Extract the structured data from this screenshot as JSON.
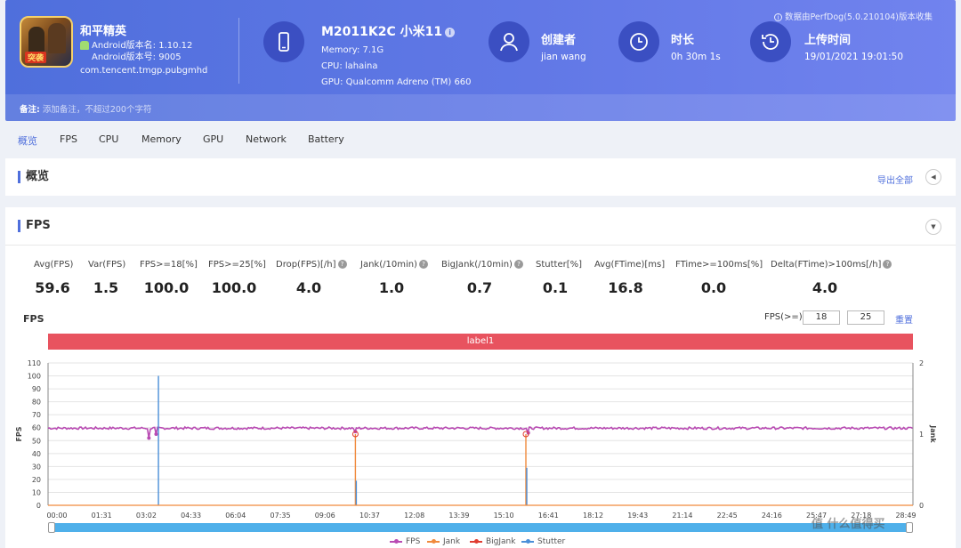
{
  "app": {
    "name": "和平精英",
    "icon_badge": "突袭",
    "version_name": "Android版本名: 1.10.12",
    "version_code": "Android版本号: 9005",
    "package": "com.tencent.tmgp.pubgmhd"
  },
  "device": {
    "name": "M2011K2C 小米11",
    "memory": "Memory: 7.1G",
    "cpu": "CPU: lahaina",
    "gpu": "GPU: Qualcomm Adreno (TM) 660"
  },
  "creator": {
    "title": "创建者",
    "value": "jian wang"
  },
  "duration": {
    "title": "时长",
    "value": "0h 30m 1s"
  },
  "upload": {
    "title": "上传时间",
    "value": "19/01/2021 19:01:50"
  },
  "notice": "数据由PerfDog(5.0.210104)版本收集",
  "note": {
    "label": "备注:",
    "placeholder": "添加备注，不超过200个字符"
  },
  "tabs": [
    "概览",
    "FPS",
    "CPU",
    "Memory",
    "GPU",
    "Network",
    "Battery"
  ],
  "overview": {
    "title": "概览",
    "export": "导出全部"
  },
  "fps_section": {
    "title": "FPS"
  },
  "metrics": [
    {
      "label": "Avg(FPS)",
      "value": "59.6"
    },
    {
      "label": "Var(FPS)",
      "value": "1.5"
    },
    {
      "label": "FPS>=18[%]",
      "value": "100.0"
    },
    {
      "label": "FPS>=25[%]",
      "value": "100.0"
    },
    {
      "label": "Drop(FPS)[/h]",
      "value": "4.0"
    },
    {
      "label": "Jank(/10min)",
      "value": "1.0"
    },
    {
      "label": "BigJank(/10min)",
      "value": "0.7"
    },
    {
      "label": "Stutter[%]",
      "value": "0.1"
    },
    {
      "label": "Avg(FTime)[ms]",
      "value": "16.8"
    },
    {
      "label": "FTime>=100ms[%]",
      "value": "0.0"
    },
    {
      "label": "Delta(FTime)>100ms[/h]",
      "value": "4.0"
    }
  ],
  "chart_controls": {
    "title": "FPS",
    "threshold_label": "FPS(>=)",
    "threshold_1": "18",
    "threshold_2": "25",
    "reset": "重置",
    "label_bar": "label1"
  },
  "watermark": "值 什么值得买",
  "colors": {
    "accent": "#4f6fdc",
    "fps": "#b94bb3",
    "jank": "#f08a3c",
    "bigjank": "#e03c31",
    "stutter": "#4a8fd8",
    "label": "#e8535f"
  },
  "chart_data": {
    "type": "line",
    "ylabel": "FPS",
    "y2label": "Jank",
    "ylim": [
      0,
      110
    ],
    "y2lim": [
      0,
      2
    ],
    "yticks": [
      0,
      10,
      20,
      30,
      40,
      50,
      60,
      70,
      80,
      90,
      100,
      110
    ],
    "y2ticks": [
      0,
      1,
      2
    ],
    "xticks": [
      "00:00",
      "01:31",
      "03:02",
      "04:33",
      "06:04",
      "07:35",
      "09:06",
      "10:37",
      "12:08",
      "13:39",
      "15:10",
      "16:41",
      "18:12",
      "19:43",
      "21:14",
      "22:45",
      "24:16",
      "25:47",
      "27:18",
      "28:49"
    ],
    "xlim_seconds": [
      0,
      1801
    ],
    "grid": true,
    "legend_position": "bottom-center",
    "series": [
      {
        "name": "FPS",
        "axis": "left",
        "baseline": 59.6,
        "dips": [
          {
            "t": 210,
            "v": 52
          },
          {
            "t": 225,
            "v": 55
          },
          {
            "t": 640,
            "v": 57
          },
          {
            "t": 1000,
            "v": 56
          }
        ]
      },
      {
        "name": "Jank",
        "axis": "right",
        "events": [
          {
            "t": 640,
            "v": 1
          },
          {
            "t": 995,
            "v": 1
          }
        ]
      },
      {
        "name": "BigJank",
        "axis": "right",
        "events": []
      },
      {
        "name": "Stutter",
        "axis": "left",
        "events": [
          {
            "t": 228,
            "v": 100
          },
          {
            "t": 640,
            "v": 19
          },
          {
            "t": 995,
            "v": 29
          }
        ]
      }
    ]
  }
}
